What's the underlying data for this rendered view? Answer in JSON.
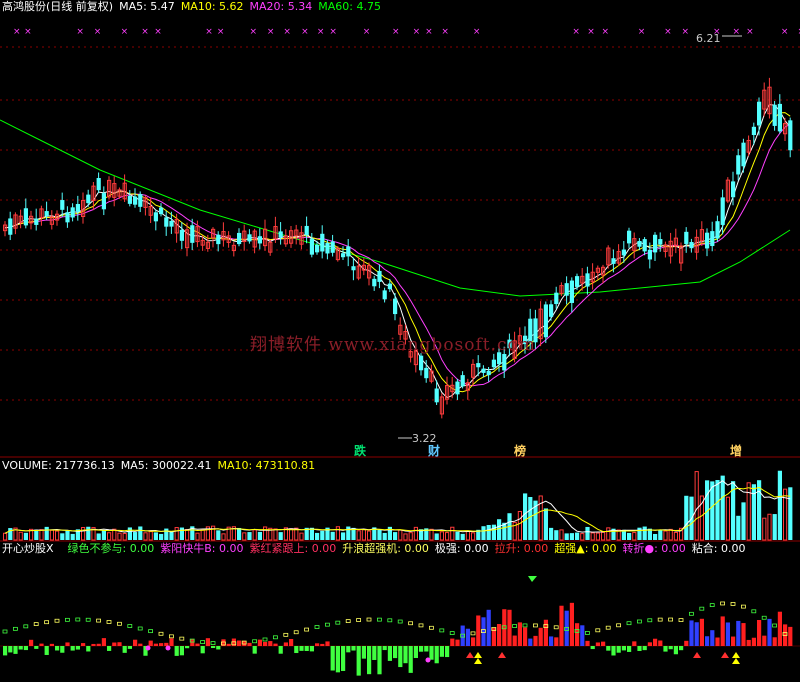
{
  "main_header": {
    "title": "高鸿股份(日线 前复权)",
    "ma5": "MA5: 5.47",
    "ma10": "MA10: 5.62",
    "ma20": "MA20: 5.34",
    "ma60": "MA60: 4.75"
  },
  "price_labels": {
    "high": "6.21",
    "low": "3.22"
  },
  "watermark": "翔博软件 www.xiangbosoft.com",
  "signal_tags": [
    {
      "text": "跌",
      "color": "#00e070"
    },
    {
      "text": "财",
      "color": "#60c8ff"
    },
    {
      "text": "榜",
      "color": "#ffd060"
    },
    {
      "text": "增",
      "color": "#ffd060"
    }
  ],
  "volume_header": {
    "volume": "VOLUME: 217736.13",
    "ma5": "MA5: 300022.41",
    "ma10": "MA10: 473110.81"
  },
  "indicator_header": {
    "name": "开心炒股X",
    "items": [
      {
        "label": "绿色不参与: 0.00",
        "color": "#40ff40"
      },
      {
        "label": "紫阳快牛B: 0.00",
        "color": "#ff40ff"
      },
      {
        "label": "紫红紧跟上: 0.00",
        "color": "#ff3060"
      },
      {
        "label": "升浪超强机: 0.00",
        "color": "#ffff60"
      },
      {
        "label": "极强: 0.00",
        "color": "#ffffff"
      },
      {
        "label": "拉升: 0.00",
        "color": "#ff3030"
      },
      {
        "label": "超强▲: 0.00",
        "color": "#ffff00"
      },
      {
        "label": "转折●: 0.00",
        "color": "#ff40ff"
      },
      {
        "label": "粘合: 0.00",
        "color": "#ffffff"
      }
    ]
  },
  "colors": {
    "up": "#ff3c3c",
    "down": "#54ffff",
    "ma5": "#ffffff",
    "ma10": "#ffff00",
    "ma20": "#ff40ff",
    "ma60": "#00ff00",
    "grid": "#8b0000"
  }
}
